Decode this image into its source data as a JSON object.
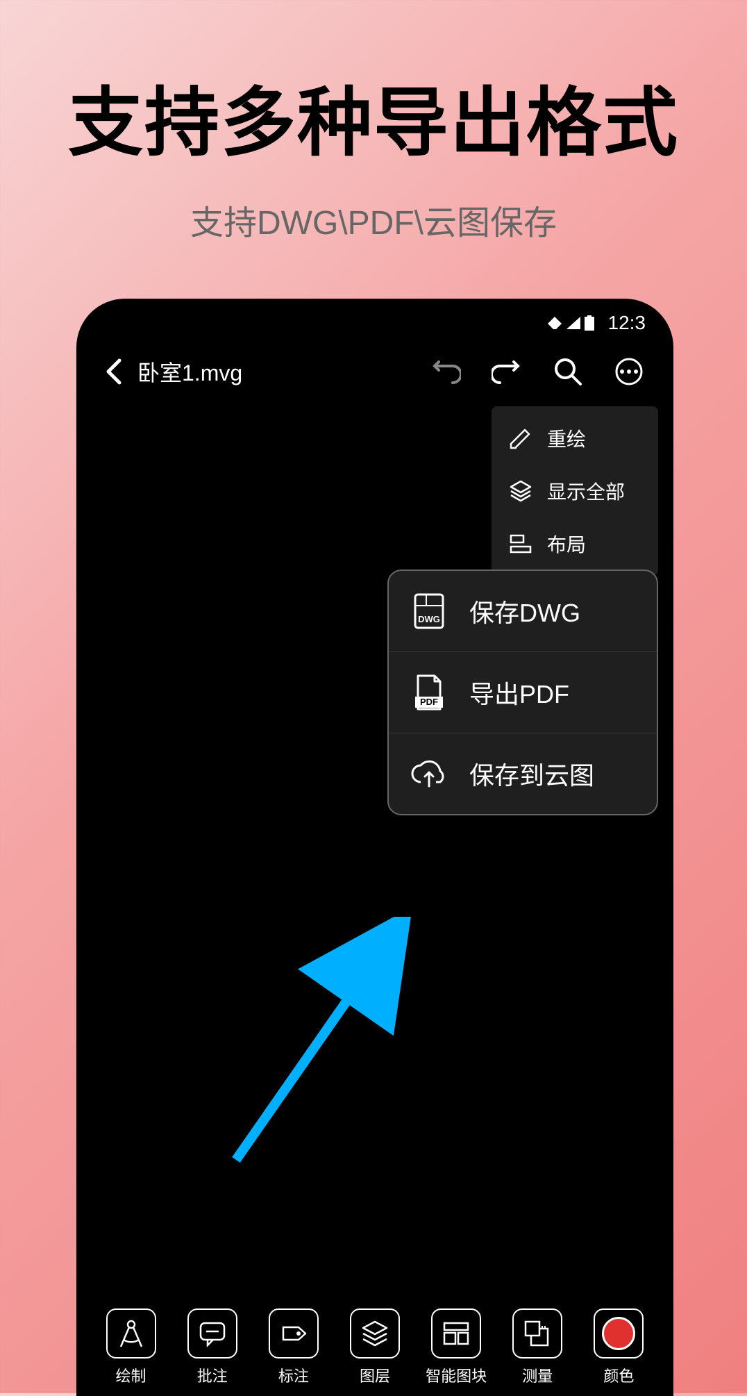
{
  "page": {
    "title": "支持多种导出格式",
    "subtitle": "支持DWG\\PDF\\云图保存"
  },
  "status": {
    "time": "12:3"
  },
  "header": {
    "filename": "卧室1.mvg"
  },
  "dropdown": {
    "items": [
      {
        "label": "重绘"
      },
      {
        "label": "显示全部"
      },
      {
        "label": "布局"
      }
    ]
  },
  "export": {
    "items": [
      {
        "label": "保存DWG",
        "badge": "DWG"
      },
      {
        "label": "导出PDF",
        "badge": "PDF"
      },
      {
        "label": "保存到云图",
        "badge": ""
      }
    ]
  },
  "toolbar": {
    "items": [
      {
        "label": "绘制"
      },
      {
        "label": "批注"
      },
      {
        "label": "标注"
      },
      {
        "label": "图层"
      },
      {
        "label": "智能图块"
      },
      {
        "label": "测量"
      },
      {
        "label": "颜色"
      }
    ]
  }
}
